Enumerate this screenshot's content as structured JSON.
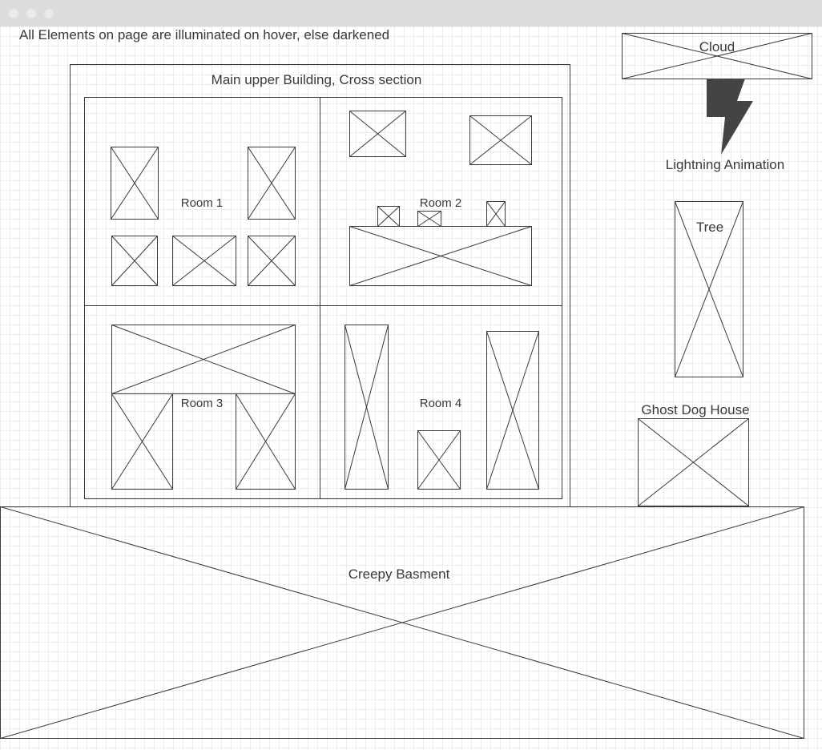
{
  "window": {
    "controls": [
      "close",
      "minimize",
      "maximize"
    ]
  },
  "note": "All Elements on page are illuminated on hover, else darkened",
  "building": {
    "title": "Main upper Building, Cross section",
    "rooms": [
      "Room 1",
      "Room 2",
      "Room 3",
      "Room 4"
    ]
  },
  "cloud": "Cloud",
  "lightning": "Lightning Animation",
  "tree": "Tree",
  "dog_house": "Ghost Dog House",
  "basement": "Creepy Basment",
  "colors": {
    "stroke": "#3a3a3a",
    "lightning_fill": "#444444",
    "titlebar": "#dcdcdc",
    "grid": "#ececec"
  }
}
